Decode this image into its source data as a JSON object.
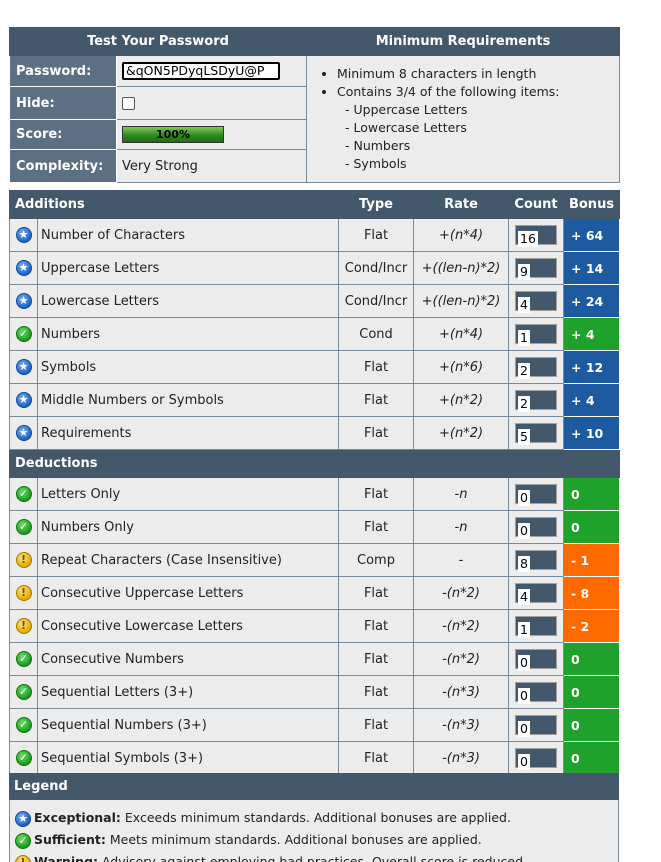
{
  "summary": {
    "title": "Test Your Password",
    "password_label": "Password:",
    "password_value": "&qON5PDyqLSDyU@P",
    "hide_label": "Hide:",
    "score_label": "Score:",
    "score_value": "100%",
    "score_fraction": 1.0,
    "complexity_label": "Complexity:",
    "complexity_value": "Very Strong"
  },
  "requirements": {
    "title": "Minimum Requirements",
    "items": [
      "Minimum 8 characters in length",
      "Contains 3/4 of the following items:"
    ],
    "subitems": [
      "- Uppercase Letters",
      "- Lowercase Letters",
      "- Numbers",
      "- Symbols"
    ]
  },
  "columns": {
    "additions": "Additions",
    "type": "Type",
    "rate": "Rate",
    "count": "Count",
    "bonus": "Bonus",
    "deductions": "Deductions"
  },
  "additions": [
    {
      "icon": "exceptional-icon",
      "name": "Number of Characters",
      "type": "Flat",
      "rate": "+(n*4)",
      "count": "16",
      "bonus": "+ 64",
      "color": "blue"
    },
    {
      "icon": "exceptional-icon",
      "name": "Uppercase Letters",
      "type": "Cond/Incr",
      "rate": "+((len-n)*2)",
      "count": "9",
      "bonus": "+ 14",
      "color": "blue"
    },
    {
      "icon": "exceptional-icon",
      "name": "Lowercase Letters",
      "type": "Cond/Incr",
      "rate": "+((len-n)*2)",
      "count": "4",
      "bonus": "+ 24",
      "color": "blue"
    },
    {
      "icon": "sufficient-icon",
      "name": "Numbers",
      "type": "Cond",
      "rate": "+(n*4)",
      "count": "1",
      "bonus": "+ 4",
      "color": "green"
    },
    {
      "icon": "exceptional-icon",
      "name": "Symbols",
      "type": "Flat",
      "rate": "+(n*6)",
      "count": "2",
      "bonus": "+ 12",
      "color": "blue"
    },
    {
      "icon": "exceptional-icon",
      "name": "Middle Numbers or Symbols",
      "type": "Flat",
      "rate": "+(n*2)",
      "count": "2",
      "bonus": "+ 4",
      "color": "blue"
    },
    {
      "icon": "exceptional-icon",
      "name": "Requirements",
      "type": "Flat",
      "rate": "+(n*2)",
      "count": "5",
      "bonus": "+ 10",
      "color": "blue"
    }
  ],
  "deductions": [
    {
      "icon": "sufficient-icon",
      "name": "Letters Only",
      "type": "Flat",
      "rate": "-n",
      "count": "0",
      "bonus": "0",
      "color": "green"
    },
    {
      "icon": "sufficient-icon",
      "name": "Numbers Only",
      "type": "Flat",
      "rate": "-n",
      "count": "0",
      "bonus": "0",
      "color": "green"
    },
    {
      "icon": "warning-icon",
      "name": "Repeat Characters (Case Insensitive)",
      "type": "Comp",
      "rate": "-",
      "count": "8",
      "bonus": "- 1",
      "color": "orange"
    },
    {
      "icon": "warning-icon",
      "name": "Consecutive Uppercase Letters",
      "type": "Flat",
      "rate": "-(n*2)",
      "count": "4",
      "bonus": "- 8",
      "color": "orange"
    },
    {
      "icon": "warning-icon",
      "name": "Consecutive Lowercase Letters",
      "type": "Flat",
      "rate": "-(n*2)",
      "count": "1",
      "bonus": "- 2",
      "color": "orange"
    },
    {
      "icon": "sufficient-icon",
      "name": "Consecutive Numbers",
      "type": "Flat",
      "rate": "-(n*2)",
      "count": "0",
      "bonus": "0",
      "color": "green"
    },
    {
      "icon": "sufficient-icon",
      "name": "Sequential Letters (3+)",
      "type": "Flat",
      "rate": "-(n*3)",
      "count": "0",
      "bonus": "0",
      "color": "green"
    },
    {
      "icon": "sufficient-icon",
      "name": "Sequential Numbers (3+)",
      "type": "Flat",
      "rate": "-(n*3)",
      "count": "0",
      "bonus": "0",
      "color": "green"
    },
    {
      "icon": "sufficient-icon",
      "name": "Sequential Symbols (3+)",
      "type": "Flat",
      "rate": "-(n*3)",
      "count": "0",
      "bonus": "0",
      "color": "green"
    }
  ],
  "legend": {
    "title": "Legend",
    "items": [
      {
        "icon": "exceptional-icon",
        "term": "Exceptional:",
        "desc": "Exceeds minimum standards. Additional bonuses are applied."
      },
      {
        "icon": "sufficient-icon",
        "term": "Sufficient:",
        "desc": "Meets minimum standards. Additional bonuses are applied."
      },
      {
        "icon": "warning-icon",
        "term": "Warning:",
        "desc": "Advisory against employing bad practices. Overall score is reduced."
      }
    ]
  },
  "colors": {
    "header": "#44586c",
    "label": "#5c7083",
    "cell": "#ececec",
    "blue": "#1e5aa0",
    "green": "#1fa22b",
    "orange": "#ff6a00"
  }
}
